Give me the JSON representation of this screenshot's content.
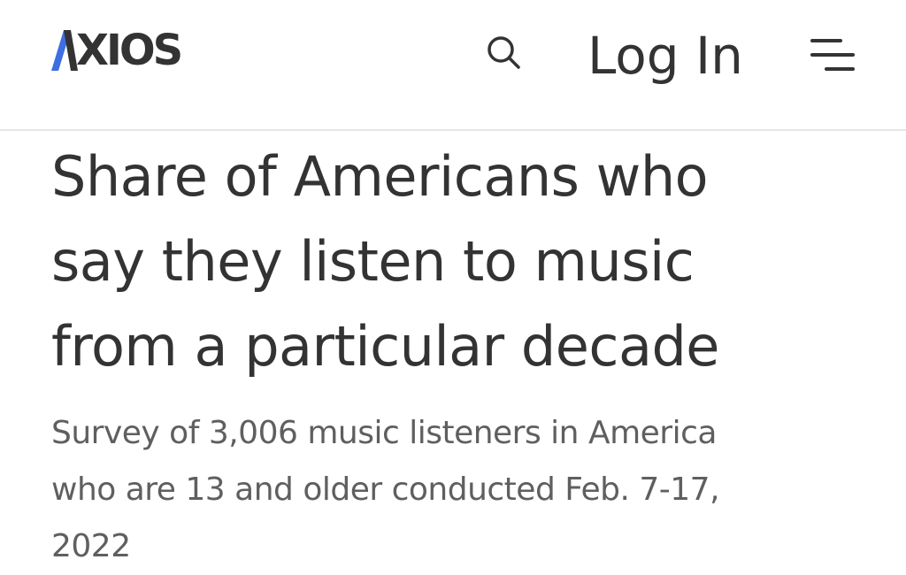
{
  "header": {
    "logo_text": "AXIOS",
    "logo_accent_color": "#3d6fe0",
    "search_icon": "search-icon",
    "login_label": "Log In",
    "menu_icon": "hamburger-menu-icon"
  },
  "article": {
    "title_lines": [
      "Share of Americans who",
      "say they listen to music",
      "from a particular decade"
    ],
    "subtitle_lines": [
      "Survey of 3,006 music listeners in America",
      "who are 13 and older conducted Feb. 7-17,",
      "2022"
    ]
  }
}
